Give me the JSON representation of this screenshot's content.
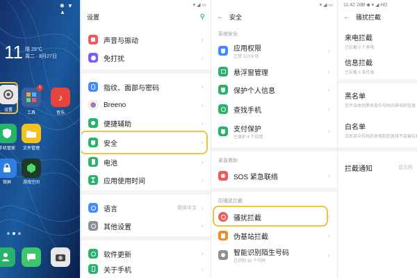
{
  "home": {
    "status_icons": "✱ ▼ ▲",
    "time": "11",
    "weather": "晴 29℃",
    "date": "周二 · 8月27日",
    "apps": [
      {
        "label": "设置"
      },
      {
        "label": "工具"
      },
      {
        "label": "音乐"
      },
      {
        "label": "手机管家"
      },
      {
        "label": "文件管理"
      },
      {
        "label": "锁屏"
      },
      {
        "label": "游戏空间"
      }
    ],
    "tools_badge": "1"
  },
  "settings": {
    "title": "设置",
    "status_left": "",
    "status_right": "▾ ◢ ▭",
    "items": [
      {
        "label": "声音与振动"
      },
      {
        "label": "免打扰"
      },
      {
        "label": "指纹、面部与密码"
      },
      {
        "label": "Breeno"
      },
      {
        "label": "便捷辅助"
      },
      {
        "label": "安全"
      },
      {
        "label": "电池"
      },
      {
        "label": "应用使用时间"
      },
      {
        "label": "语言",
        "value": "简体中文"
      },
      {
        "label": "其他设置"
      },
      {
        "label": "软件更新"
      },
      {
        "label": "关于手机"
      }
    ]
  },
  "security": {
    "title": "安全",
    "status_right": "▾ ◢ ▭",
    "section1": "系统安全",
    "items1": [
      {
        "label": "应用权限",
        "sub": "已禁 12/19 项"
      },
      {
        "label": "悬浮窗管理"
      },
      {
        "label": "保护个人信息"
      },
      {
        "label": "查找手机"
      },
      {
        "label": "支付保护",
        "sub": "已保护 4 个应用"
      }
    ],
    "section2": "紧急救助",
    "sos": "SOS 紧急联络",
    "section3": "防骚扰拦截",
    "items3": [
      {
        "label": "骚扰拦截"
      },
      {
        "label": "伪基站拦截"
      },
      {
        "label": "智能识别陌生号码",
        "sub": "已识别 16 个号码"
      }
    ]
  },
  "block": {
    "status": "11:42 2dB ◆ ▾ ◢ HD",
    "title": "骚扰拦截",
    "items": [
      {
        "label": "来电拦截",
        "sub": "已拦截 0 个来电"
      },
      {
        "label": "信息拦截",
        "sub": "已拦截 0 条信息"
      },
      {
        "label": "黑名单",
        "sub": "您不会收到黑名单中号码的来电和信息"
      },
      {
        "label": "白名单",
        "sub": "白名单中号码的来电和信息将不会被拦截"
      },
      {
        "label": "拦截通知",
        "value": "显示所"
      }
    ]
  },
  "colors": {
    "accent_green": "#1aa364",
    "highlight": "#f1c23a"
  }
}
